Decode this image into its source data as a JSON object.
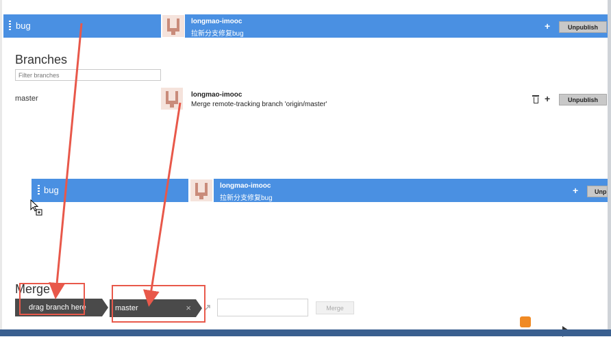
{
  "selected_branch": {
    "name": "bug",
    "author": "longmao-imooc",
    "message": "拉新分支修复bug",
    "add_label": "+",
    "unpublish_label": "Unpublish"
  },
  "branches": {
    "heading": "Branches",
    "filter_placeholder": "Filter branches",
    "items": [
      {
        "name": "master",
        "author": "longmao-imooc",
        "message": "Merge remote-tracking branch 'origin/master'",
        "add_label": "+",
        "unpublish_label": "Unpublish"
      }
    ]
  },
  "dragging_branch": {
    "name": "bug",
    "author": "longmao-imooc",
    "message": "拉新分支修复bug",
    "add_label": "+",
    "unpublish_label": "Unp"
  },
  "merge": {
    "heading": "Merge",
    "source_placeholder": "drag branch here",
    "target_value": "master",
    "target_clear": "×",
    "button_label": "Merge"
  },
  "colors": {
    "accent": "#4a90e2",
    "annotation": "#e8584a"
  }
}
